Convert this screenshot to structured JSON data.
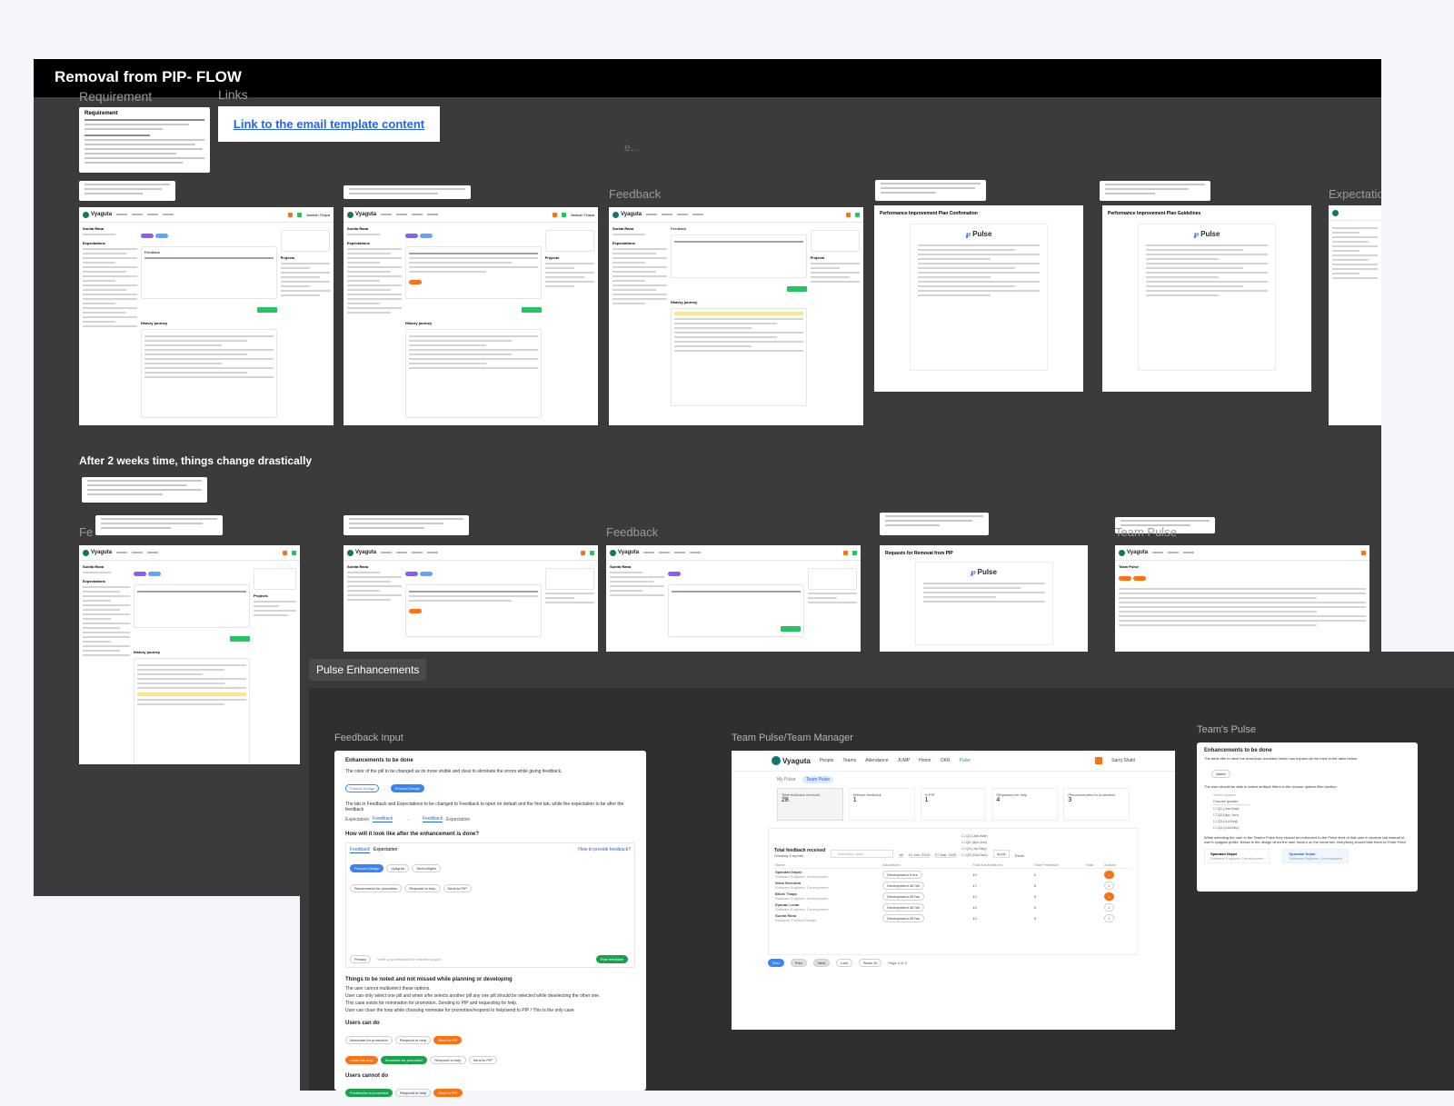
{
  "board": {
    "title": "Removal from PIP- FLOW",
    "requirement_label": "Requirement",
    "requirement_heading": "Requirement",
    "links_label": "Links",
    "email_link": "Link to the email template content",
    "faded_e": "e...",
    "feedback_label_row1": "Feedback",
    "section2_title": "After 2 weeks time, things change drastically",
    "feedback_label_row2": "Feedback",
    "row2_left_partial": "Fe",
    "row2_right_partial": "Team Pulse",
    "row1_right_partial": "Expectation"
  },
  "frames": {
    "app_name": "Vyaguta",
    "user_name": "Ashesh Thapa",
    "employee_name": "Sunita Rana",
    "expectations_heading": "Expectations",
    "feedback_tab": "Feedback",
    "history_heading": "History journey",
    "projects_heading": "Projects",
    "post_button": "Post feedback",
    "doc_title_1": "Performance Improvement Plan Confirmation",
    "doc_title_2": "Performance Improvement Plan Guidelines",
    "doc_title_3": "Requests for Removal from PIP",
    "pulse_brand": "Pulse",
    "team_pulse_title": "Team Pulse"
  },
  "pulse_enhancements": {
    "tag": "Pulse Enhancements",
    "feedback_input": {
      "label": "Feedback Input",
      "heading": "Enhancements to be done",
      "point1": "The color of the pill to be changed as its more visible and clear to eliminate the errors while giving feedback.",
      "pill_product_design": "Product Design",
      "point2": "The tab in Feedback and Expectations to be changed to Feedback to open on default and the first tab, while the expectation to be after the feedback",
      "tab_expectation": "Expectation",
      "tab_feedback": "Feedback",
      "how_look": "How will it look like after the enhancement is done?",
      "how_to_feedback": "How to provide feedback?",
      "pill_vyaguta": "Vyaguta",
      "pill_technoligies": "Technoligies",
      "rec_promotion": "Recommend for promotion",
      "respond_help": "Respond to help",
      "send_pip": "Send to PIP",
      "privacy": "Privacy",
      "post_placeholder": "Write your feedback for selected project",
      "post_feedback": "Post feedback",
      "notes_heading": "Things to be noted and not missed while planning or developing",
      "note1": "The user cannot multiselect these options.",
      "note2": "User can only select one pill and when s/he selects another pill any one pill should be selected while deselecting the other one.",
      "note3": "This case exists for nomination for promotion, Sending to PIP and requesting for help.",
      "note4": "User can close the loop while choosing nominate for promotion/respond to help/send to PIP / This is the only case",
      "users_can_do": "Users can do",
      "nominate": "Nominate for promotion",
      "send_pip_short": "Send to PIP",
      "close_loop": "Close the loop",
      "users_cannot_do": "Users cannot do",
      "feedbacks_to_promoted": "Feedbacks to promoted"
    },
    "team_manager": {
      "label": "Team Pulse/Team Manager",
      "app": "Vyaguta",
      "nav": [
        "People",
        "Teams",
        "Attendance",
        "JUMP",
        "Honor",
        "OKR",
        "Pulse"
      ],
      "user": "Saroj Shahi",
      "tab_my": "My Pulse",
      "tab_team": "Team Pulse",
      "stats": [
        {
          "label": "Total feedback received",
          "value": "28"
        },
        {
          "label": "Without feedback",
          "value": "1"
        },
        {
          "label": "In PIP",
          "value": "1"
        },
        {
          "label": "Requested for help",
          "value": "4"
        },
        {
          "label": "Recommended for promotion",
          "value": "3"
        }
      ],
      "table_title": "Total feedback received",
      "table_sub": "Showing 5 reports",
      "search_placeholder": "Search by name",
      "project_label": "Project",
      "project_value": "All",
      "start_date": "01 Jan, 2023",
      "end_date": "07 Mar, 2023",
      "apply": "Apply",
      "reset": "Reset",
      "quarters": [
        "Q1 (Jan-Mar)",
        "Q2 (Apr-Jun)",
        "Q3 (Jul-Sep)",
        "Q4 (Oct-Dec)"
      ],
      "columns": [
        "Name",
        "Allocations",
        "Total Expectations",
        "Total Feedback",
        "Total",
        "Actions"
      ],
      "rows": [
        {
          "name": "Spandan Nepal",
          "role": "Software Engineer, Development",
          "alloc": "Development  0 hrs",
          "a": "19",
          "b": "2"
        },
        {
          "name": "Neha Shrestha",
          "role": "Software Engineer, Development",
          "alloc": "Development  40 hrs",
          "a": "17",
          "b": "5"
        },
        {
          "name": "Bibek Thapa",
          "role": "Software Engineer, Development",
          "alloc": "Development  20 hrs",
          "a": "14",
          "b": "3"
        },
        {
          "name": "Dyanan Lohar",
          "role": "Software Engineer, Development",
          "alloc": "Development  40 hrs",
          "a": "14",
          "b": "4"
        },
        {
          "name": "Sunita Rana",
          "role": "Designer, Product Design",
          "alloc": "Development  20 hrs",
          "a": "12",
          "b": "3"
        }
      ],
      "pg_first": "First",
      "pg_prev": "Prev",
      "pg_next": "Next",
      "pg_last": "Last",
      "show": "Show 10",
      "page": "Page 1 of 3"
    },
    "teams_pulse": {
      "label": "Team's Pulse",
      "heading": "Enhancements to be done",
      "point1": "The table title to have the download checkbox which can expand all the rows in the table below.",
      "name_btn": "Name",
      "point2": "The user should be able to select multiple filters in the choose quarter filter section.",
      "select_quarter": "Select quarter",
      "choose_quarter": "Choose quarter",
      "quarters": [
        "Q1 (Jan-Mar)",
        "Q2 (Apr-Jun)",
        "Q3 (Jul-Sep)",
        "Q4 (Oct-Dec)"
      ],
      "point3": "While selecting the user in the Team's Pulse they should be redirected to the Pulse feed of that user in another tab instead of user's vyaguta profile. Below is the design when the user hovers on the name tab, everything should take them to Pulse Feed",
      "card1_name": "Spandan Nepal",
      "card1_role": "Software Engineer, Development",
      "card2_name": "Spandan Nepal",
      "card2_role": "Software Engineer, Development"
    }
  },
  "colors": {
    "board_bg": "#3b3b3b",
    "header_bg": "#000000",
    "accent_blue": "#2563eb",
    "accent_green": "#22c55e",
    "accent_orange": "#f97316",
    "accent_purple": "#8b5cf6"
  }
}
